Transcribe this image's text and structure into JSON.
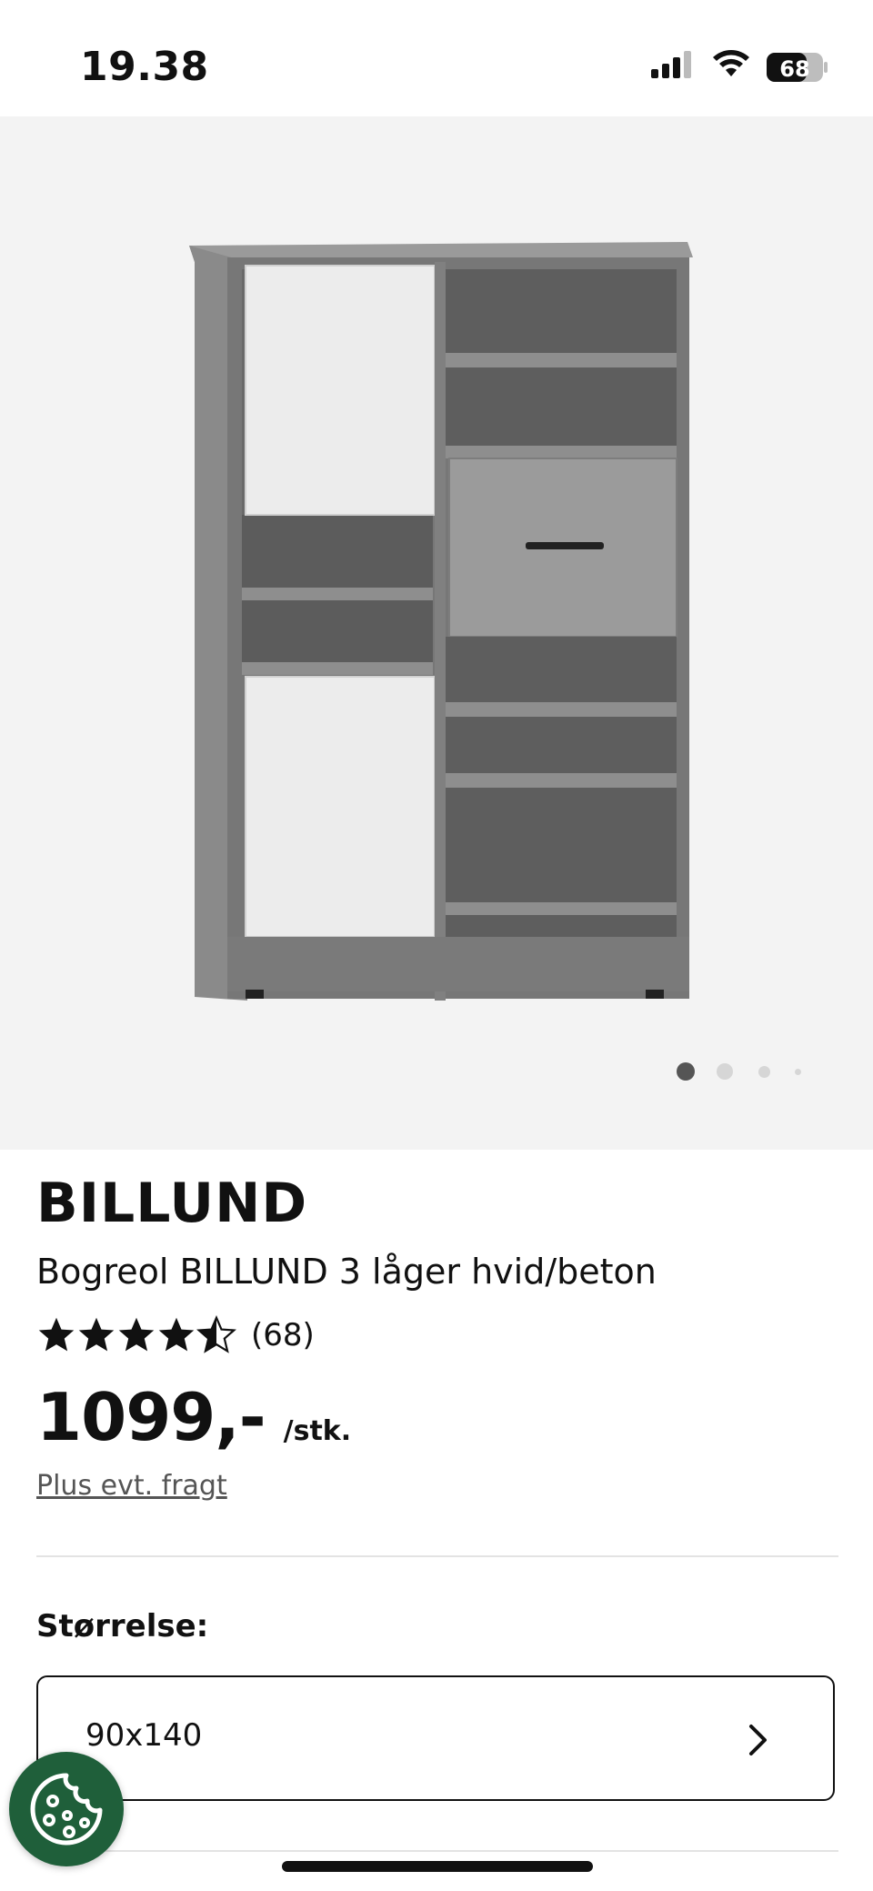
{
  "status_bar": {
    "time": "19.38",
    "battery": "68",
    "icons": [
      "signal-icon",
      "wifi-icon",
      "battery-icon"
    ]
  },
  "gallery": {
    "image_alt": "bookshelf-image",
    "image_count": 4,
    "active_index": 0
  },
  "product": {
    "brand": "BILLUND",
    "subtitle": "Bogreol BILLUND 3 låger hvid/beton",
    "rating": 4.5,
    "review_count": "(68)",
    "price": "1099,-",
    "unit": "/stk.",
    "shipping_link": "Plus evt. fragt"
  },
  "size": {
    "label": "Størrelse:",
    "value": "90x140"
  },
  "colors": {
    "accent_green": "#1f5f3a",
    "gallery_bg": "#f3f3f3"
  }
}
